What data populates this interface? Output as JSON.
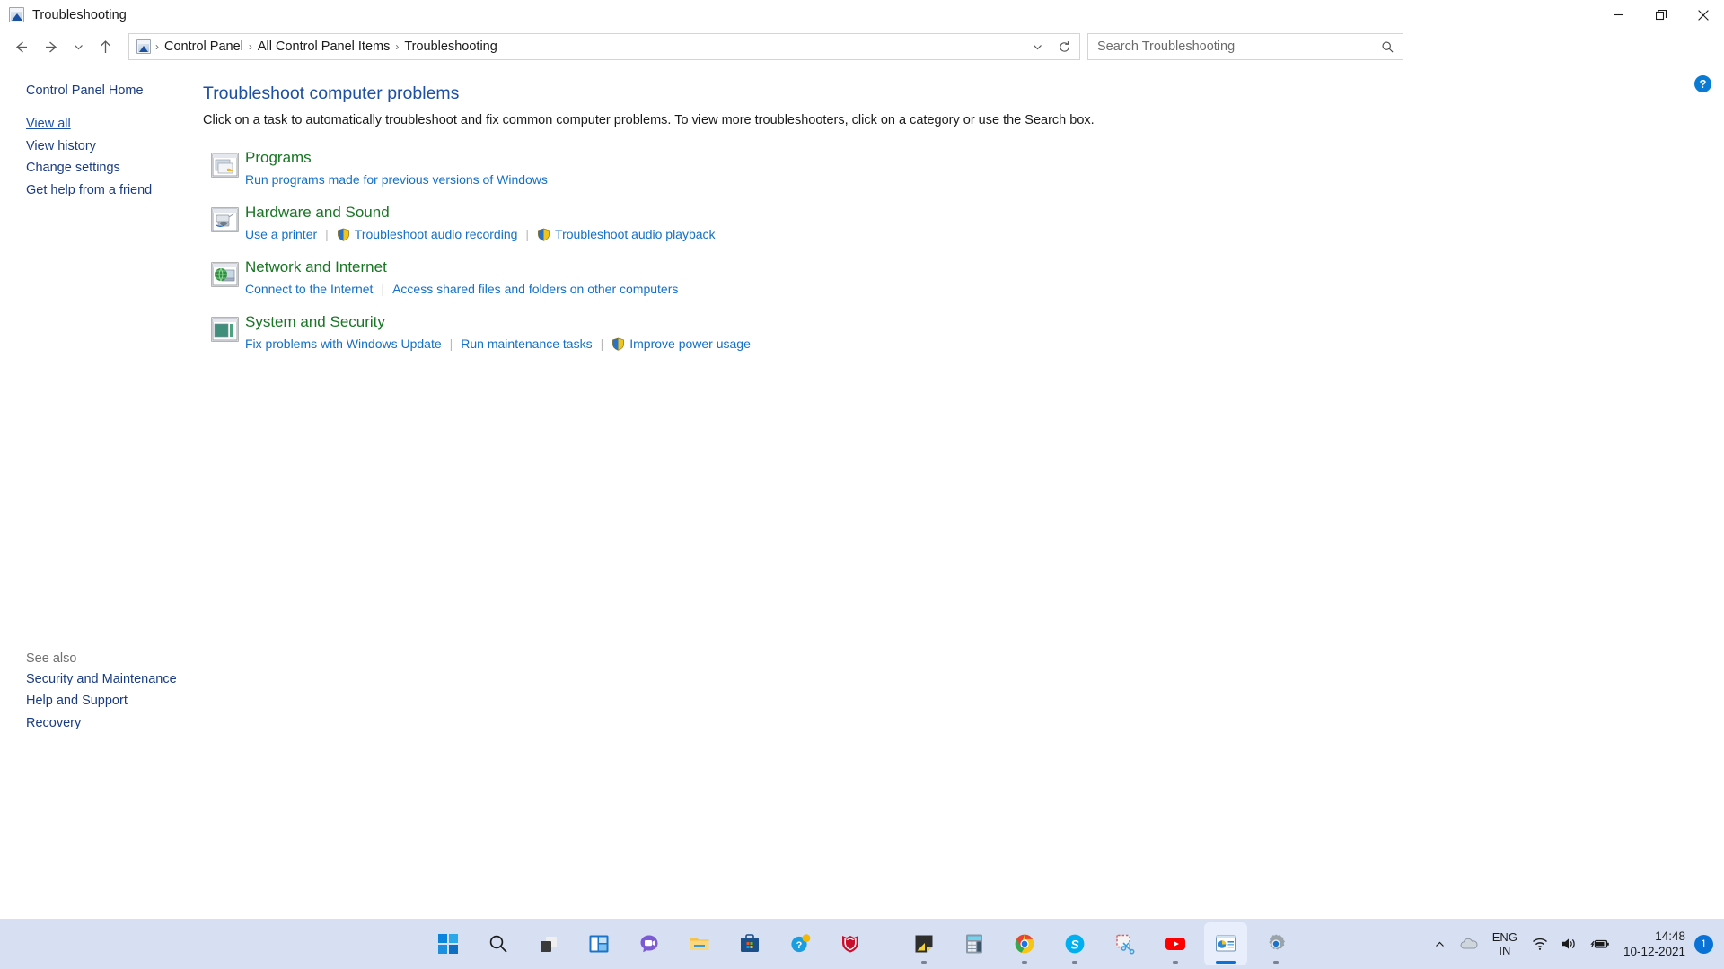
{
  "window": {
    "title": "Troubleshooting",
    "app_icon": "troubleshooting-icon",
    "minimize_label": "Minimize",
    "restore_label": "Restore",
    "close_label": "Close"
  },
  "addressbar": {
    "back_label": "Back",
    "forward_label": "Forward",
    "recent_label": "Recent locations",
    "up_label": "Up",
    "breadcrumb": [
      "Control Panel",
      "All Control Panel Items",
      "Troubleshooting"
    ],
    "separator": "›",
    "dropdown_label": "Previous locations",
    "refresh_label": "Refresh"
  },
  "search": {
    "placeholder": "Search Troubleshooting",
    "value": "",
    "icon": "search-icon"
  },
  "help": {
    "label": "?",
    "tooltip": "Help"
  },
  "sidebar": {
    "home": "Control Panel Home",
    "links": [
      {
        "label": "View all",
        "hovered": true
      },
      {
        "label": "View history",
        "hovered": false
      },
      {
        "label": "Change settings",
        "hovered": false
      },
      {
        "label": "Get help from a friend",
        "hovered": false
      }
    ],
    "see_also_title": "See also",
    "see_also": [
      "Security and Maintenance",
      "Help and Support",
      "Recovery"
    ]
  },
  "main": {
    "title": "Troubleshoot computer problems",
    "description": "Click on a task to automatically troubleshoot and fix common computer problems. To view more troubleshooters, click on a category or use the Search box.",
    "categories": [
      {
        "title": "Programs",
        "icon": "programs-icon",
        "tasks": [
          {
            "label": "Run programs made for previous versions of Windows",
            "shield": false
          }
        ]
      },
      {
        "title": "Hardware and Sound",
        "icon": "hardware-and-sound-icon",
        "tasks": [
          {
            "label": "Use a printer",
            "shield": false
          },
          {
            "label": "Troubleshoot audio recording",
            "shield": true
          },
          {
            "label": "Troubleshoot audio playback",
            "shield": true
          }
        ]
      },
      {
        "title": "Network and Internet",
        "icon": "network-and-internet-icon",
        "tasks": [
          {
            "label": "Connect to the Internet",
            "shield": false
          },
          {
            "label": "Access shared files and folders on other computers",
            "shield": false
          }
        ]
      },
      {
        "title": "System and Security",
        "icon": "system-and-security-icon",
        "tasks": [
          {
            "label": "Fix problems with Windows Update",
            "shield": false
          },
          {
            "label": "Run maintenance tasks",
            "shield": false
          },
          {
            "label": "Improve power usage",
            "shield": true
          }
        ]
      }
    ]
  },
  "taskbar": {
    "items": [
      {
        "name": "start-button",
        "running": false,
        "active": false
      },
      {
        "name": "search-taskbar-icon",
        "running": false,
        "active": false
      },
      {
        "name": "task-view-icon",
        "running": false,
        "active": false
      },
      {
        "name": "widgets-icon",
        "running": false,
        "active": false
      },
      {
        "name": "chat-teams-icon",
        "running": false,
        "active": false
      },
      {
        "name": "file-explorer-icon",
        "running": false,
        "active": false
      },
      {
        "name": "microsoft-store-icon",
        "running": false,
        "active": false
      },
      {
        "name": "get-help-icon",
        "running": false,
        "active": false
      },
      {
        "name": "mcafee-icon",
        "running": false,
        "active": false
      },
      {
        "name": "sticky-notes-icon",
        "running": true,
        "active": false
      },
      {
        "name": "calculator-icon",
        "running": false,
        "active": false
      },
      {
        "name": "google-chrome-icon",
        "running": true,
        "active": false
      },
      {
        "name": "skype-icon",
        "running": true,
        "active": false
      },
      {
        "name": "snipping-tool-icon",
        "running": false,
        "active": false
      },
      {
        "name": "youtube-icon",
        "running": true,
        "active": false
      },
      {
        "name": "control-panel-icon",
        "running": true,
        "active": true
      },
      {
        "name": "settings-icon",
        "running": true,
        "active": false
      }
    ],
    "tray": {
      "show_hidden_label": "Show hidden icons",
      "onedrive_icon": "onedrive-icon",
      "language_primary": "ENG",
      "language_secondary": "IN",
      "network_icon": "wifi-icon",
      "volume_icon": "volume-icon",
      "battery_icon": "battery-charging-icon",
      "time": "14:48",
      "date": "10-12-2021",
      "notification_count": "1"
    }
  },
  "colors": {
    "accent_blue": "#0a72d6",
    "link_blue": "#1470c8",
    "heading_blue": "#1d4fa5",
    "category_green": "#187524",
    "sidebar_link": "#1a3c82",
    "taskbar_bg": "#d6e0f2"
  }
}
